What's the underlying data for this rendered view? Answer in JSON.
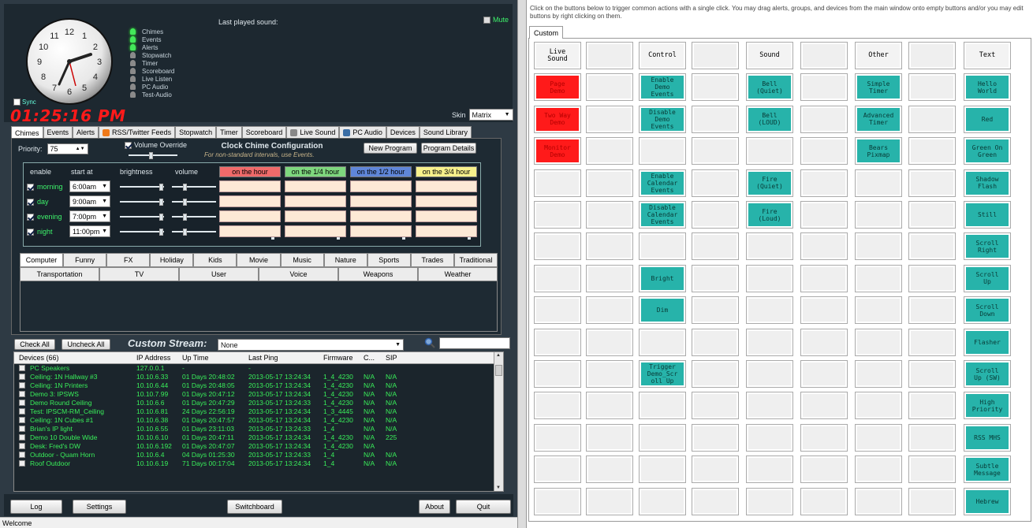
{
  "clock": {
    "time": "01:25:16 PM",
    "sync_label": "Sync",
    "numbers": [
      "12",
      "1",
      "2",
      "3",
      "4",
      "5",
      "6",
      "7",
      "8",
      "9",
      "10",
      "11"
    ]
  },
  "indicators": [
    {
      "label": "Chimes",
      "on": true
    },
    {
      "label": "Events",
      "on": true
    },
    {
      "label": "Alerts",
      "on": true
    },
    {
      "label": "Stopwatch",
      "on": false
    },
    {
      "label": "Timer",
      "on": false
    },
    {
      "label": "Scoreboard",
      "on": false
    },
    {
      "label": "Live Listen",
      "on": false
    },
    {
      "label": "PC Audio",
      "on": false
    },
    {
      "label": "Test-Audio",
      "on": false
    }
  ],
  "last_played_label": "Last played sound:",
  "mute_label": "Mute",
  "skin": {
    "label": "Skin",
    "value": "Matrix"
  },
  "tabs": [
    "Chimes",
    "Events",
    "Alerts",
    "RSS/Twitter Feeds",
    "Stopwatch",
    "Timer",
    "Scoreboard",
    "Live Sound",
    "PC Audio",
    "Devices",
    "Sound Library"
  ],
  "chimes": {
    "priority_label": "Priority:",
    "priority_value": "75",
    "volume_override": "Volume Override",
    "title": "Clock Chime Configuration",
    "subtitle": "For non-standard intervals, use Events.",
    "new_program": "New Program",
    "program_details": "Program Details",
    "headers": {
      "enable": "enable",
      "start_at": "start at",
      "brightness": "brightness",
      "volume": "volume"
    },
    "columns": [
      {
        "label": "on the hour",
        "color": "#f06a6a"
      },
      {
        "label": "on the 1/4 hour",
        "color": "#7ed77e"
      },
      {
        "label": "on the 1/2 hour",
        "color": "#5f86d9"
      },
      {
        "label": "on the 3/4 hour",
        "color": "#f7f18c"
      }
    ],
    "rows": [
      {
        "label": "morning",
        "time": "6:00am"
      },
      {
        "label": "day",
        "time": "9:00am"
      },
      {
        "label": "evening",
        "time": "7:00pm"
      },
      {
        "label": "night",
        "time": "11:00pm"
      }
    ]
  },
  "categories_row1": [
    "Computer",
    "Funny",
    "FX",
    "Holiday",
    "Kids",
    "Movie",
    "Music",
    "Nature",
    "Sports",
    "Trades",
    "Traditional"
  ],
  "categories_row2": [
    "Transportation",
    "TV",
    "User",
    "Voice",
    "Weapons",
    "Weather"
  ],
  "stream": {
    "check_all": "Check All",
    "uncheck_all": "Uncheck All",
    "label": "Custom Stream:",
    "value": "None"
  },
  "devices": {
    "headers": [
      "Devices (66)",
      "IP Address",
      "Up Time",
      "Last Ping",
      "Firmware",
      "C...",
      "SIP"
    ],
    "rows": [
      [
        "PC Speakers",
        "127.0.0.1",
        "-",
        "-",
        "",
        "",
        ""
      ],
      [
        "Ceiling: 1N Hallway #3",
        "10.10.6.33",
        "01 Days 20:48:02",
        "2013-05-17 13:24:34",
        "1_4_4230",
        "N/A",
        "N/A"
      ],
      [
        "Ceiling: 1N Printers",
        "10.10.6.44",
        "01 Days 20:48:05",
        "2013-05-17 13:24:34",
        "1_4_4230",
        "N/A",
        "N/A"
      ],
      [
        "Demo 3: IPSWS",
        "10.10.7.99",
        "01 Days 20:47:12",
        "2013-05-17 13:24:34",
        "1_4_4230",
        "N/A",
        "N/A"
      ],
      [
        "Demo Round Ceiling",
        "10.10.6.6",
        "01 Days 20:47:29",
        "2013-05-17 13:24:33",
        "1_4_4230",
        "N/A",
        "N/A"
      ],
      [
        "Test: IPSCM-RM_Ceiling",
        "10.10.6.81",
        "24 Days 22:56:19",
        "2013-05-17 13:24:34",
        "1_3_4445",
        "N/A",
        "N/A"
      ],
      [
        "Ceiling: 1N Cubes #1",
        "10.10.6.38",
        "01 Days 20:47:57",
        "2013-05-17 13:24:34",
        "1_4_4230",
        "N/A",
        "N/A"
      ],
      [
        "Brian's IP light",
        "10.10.6.55",
        "01 Days 23:11:03",
        "2013-05-17 13:24:33",
        "1_4",
        "N/A",
        "N/A"
      ],
      [
        "Demo 10 Double Wide",
        "10.10.6.10",
        "01 Days 20:47:11",
        "2013-05-17 13:24:34",
        "1_4_4230",
        "N/A",
        "225"
      ],
      [
        "Desk: Fred's DW",
        "10.10.6.192",
        "01 Days 20:47:07",
        "2013-05-17 13:24:34",
        "1_4_4230",
        "N/A",
        ""
      ],
      [
        "Outdoor - Quam Horn",
        "10.10.6.4",
        "04 Days 01:25:30",
        "2013-05-17 13:24:33",
        "1_4",
        "N/A",
        "N/A"
      ],
      [
        "Roof Outdoor",
        "10.10.6.19",
        "71 Days 00:17:04",
        "2013-05-17 13:24:34",
        "1_4",
        "N/A",
        "N/A"
      ]
    ]
  },
  "bottom": {
    "log": "Log",
    "settings": "Settings",
    "switchboard": "Switchboard",
    "about": "About",
    "quit": "Quit"
  },
  "status_text": "Welcome",
  "right": {
    "instructions": "Click on the buttons below to trigger common actions with a single click. You may drag alerts, groups, and devices from the main window onto empty buttons and/or you may edit buttons by right clicking on them.",
    "tab": "Custom",
    "grid": [
      [
        {
          "t": "Live\nSound",
          "s": "hdr"
        },
        {
          "t": "",
          "s": ""
        },
        {
          "t": "Control",
          "s": "hdr"
        },
        {
          "t": "",
          "s": ""
        },
        {
          "t": "Sound",
          "s": "hdr"
        },
        {
          "t": "",
          "s": ""
        },
        {
          "t": "Other",
          "s": "hdr"
        },
        {
          "t": "",
          "s": ""
        },
        {
          "t": "Text",
          "s": "hdr"
        }
      ],
      [
        {
          "t": "Page\nDemo",
          "s": "red"
        },
        {
          "t": "",
          "s": ""
        },
        {
          "t": "Enable\nDemo\nEvents",
          "s": "teal"
        },
        {
          "t": "",
          "s": ""
        },
        {
          "t": "Bell\n(Quiet)",
          "s": "teal"
        },
        {
          "t": "",
          "s": ""
        },
        {
          "t": "Simple\nTimer",
          "s": "teal"
        },
        {
          "t": "",
          "s": ""
        },
        {
          "t": "Hello\nWorld",
          "s": "teal"
        }
      ],
      [
        {
          "t": "Two Way\nDemo",
          "s": "red"
        },
        {
          "t": "",
          "s": ""
        },
        {
          "t": "Disable\nDemo\nEvents",
          "s": "teal"
        },
        {
          "t": "",
          "s": ""
        },
        {
          "t": "Bell\n(LOUD)",
          "s": "teal"
        },
        {
          "t": "",
          "s": ""
        },
        {
          "t": "Advanced\nTimer",
          "s": "teal"
        },
        {
          "t": "",
          "s": ""
        },
        {
          "t": "Red",
          "s": "teal"
        }
      ],
      [
        {
          "t": "Monitor\nDemo",
          "s": "red"
        },
        {
          "t": "",
          "s": ""
        },
        {
          "t": "",
          "s": ""
        },
        {
          "t": "",
          "s": ""
        },
        {
          "t": "",
          "s": ""
        },
        {
          "t": "",
          "s": ""
        },
        {
          "t": "Bears\nPixmap",
          "s": "teal"
        },
        {
          "t": "",
          "s": ""
        },
        {
          "t": "Green On\nGreen",
          "s": "teal"
        }
      ],
      [
        {
          "t": "",
          "s": ""
        },
        {
          "t": "",
          "s": ""
        },
        {
          "t": "Enable\nCalendar\nEvents",
          "s": "teal"
        },
        {
          "t": "",
          "s": ""
        },
        {
          "t": "Fire\n(Quiet)",
          "s": "teal"
        },
        {
          "t": "",
          "s": ""
        },
        {
          "t": "",
          "s": ""
        },
        {
          "t": "",
          "s": ""
        },
        {
          "t": "Shadow\nFlash",
          "s": "teal"
        }
      ],
      [
        {
          "t": "",
          "s": ""
        },
        {
          "t": "",
          "s": ""
        },
        {
          "t": "Disable\nCalendar\nEvents",
          "s": "teal"
        },
        {
          "t": "",
          "s": ""
        },
        {
          "t": "Fire\n(Loud)",
          "s": "teal"
        },
        {
          "t": "",
          "s": ""
        },
        {
          "t": "",
          "s": ""
        },
        {
          "t": "",
          "s": ""
        },
        {
          "t": "Still",
          "s": "teal"
        }
      ],
      [
        {
          "t": "",
          "s": ""
        },
        {
          "t": "",
          "s": ""
        },
        {
          "t": "",
          "s": ""
        },
        {
          "t": "",
          "s": ""
        },
        {
          "t": "",
          "s": ""
        },
        {
          "t": "",
          "s": ""
        },
        {
          "t": "",
          "s": ""
        },
        {
          "t": "",
          "s": ""
        },
        {
          "t": "Scroll\nRight",
          "s": "teal"
        }
      ],
      [
        {
          "t": "",
          "s": ""
        },
        {
          "t": "",
          "s": ""
        },
        {
          "t": "Bright",
          "s": "teal"
        },
        {
          "t": "",
          "s": ""
        },
        {
          "t": "",
          "s": ""
        },
        {
          "t": "",
          "s": ""
        },
        {
          "t": "",
          "s": ""
        },
        {
          "t": "",
          "s": ""
        },
        {
          "t": "Scroll\nUp",
          "s": "teal"
        }
      ],
      [
        {
          "t": "",
          "s": ""
        },
        {
          "t": "",
          "s": ""
        },
        {
          "t": "Dim",
          "s": "teal"
        },
        {
          "t": "",
          "s": ""
        },
        {
          "t": "",
          "s": ""
        },
        {
          "t": "",
          "s": ""
        },
        {
          "t": "",
          "s": ""
        },
        {
          "t": "",
          "s": ""
        },
        {
          "t": "Scroll\nDown",
          "s": "teal"
        }
      ],
      [
        {
          "t": "",
          "s": ""
        },
        {
          "t": "",
          "s": ""
        },
        {
          "t": "",
          "s": ""
        },
        {
          "t": "",
          "s": ""
        },
        {
          "t": "",
          "s": ""
        },
        {
          "t": "",
          "s": ""
        },
        {
          "t": "",
          "s": ""
        },
        {
          "t": "",
          "s": ""
        },
        {
          "t": "Flasher",
          "s": "teal"
        }
      ],
      [
        {
          "t": "",
          "s": ""
        },
        {
          "t": "",
          "s": ""
        },
        {
          "t": "Trigger\nDemo_Scr\noll Up",
          "s": "teal"
        },
        {
          "t": "",
          "s": ""
        },
        {
          "t": "",
          "s": ""
        },
        {
          "t": "",
          "s": ""
        },
        {
          "t": "",
          "s": ""
        },
        {
          "t": "",
          "s": ""
        },
        {
          "t": "Scroll\nUp (SW)",
          "s": "teal"
        }
      ],
      [
        {
          "t": "",
          "s": ""
        },
        {
          "t": "",
          "s": ""
        },
        {
          "t": "",
          "s": ""
        },
        {
          "t": "",
          "s": ""
        },
        {
          "t": "",
          "s": ""
        },
        {
          "t": "",
          "s": ""
        },
        {
          "t": "",
          "s": ""
        },
        {
          "t": "",
          "s": ""
        },
        {
          "t": "High\nPriority",
          "s": "teal"
        }
      ],
      [
        {
          "t": "",
          "s": ""
        },
        {
          "t": "",
          "s": ""
        },
        {
          "t": "",
          "s": ""
        },
        {
          "t": "",
          "s": ""
        },
        {
          "t": "",
          "s": ""
        },
        {
          "t": "",
          "s": ""
        },
        {
          "t": "",
          "s": ""
        },
        {
          "t": "",
          "s": ""
        },
        {
          "t": "RSS MHS",
          "s": "teal"
        }
      ],
      [
        {
          "t": "",
          "s": ""
        },
        {
          "t": "",
          "s": ""
        },
        {
          "t": "",
          "s": ""
        },
        {
          "t": "",
          "s": ""
        },
        {
          "t": "",
          "s": ""
        },
        {
          "t": "",
          "s": ""
        },
        {
          "t": "",
          "s": ""
        },
        {
          "t": "",
          "s": ""
        },
        {
          "t": "Subtle\nMessage",
          "s": "teal"
        }
      ],
      [
        {
          "t": "",
          "s": ""
        },
        {
          "t": "",
          "s": ""
        },
        {
          "t": "",
          "s": ""
        },
        {
          "t": "",
          "s": ""
        },
        {
          "t": "",
          "s": ""
        },
        {
          "t": "",
          "s": ""
        },
        {
          "t": "",
          "s": ""
        },
        {
          "t": "",
          "s": ""
        },
        {
          "t": "Hebrew",
          "s": "teal"
        }
      ]
    ]
  }
}
